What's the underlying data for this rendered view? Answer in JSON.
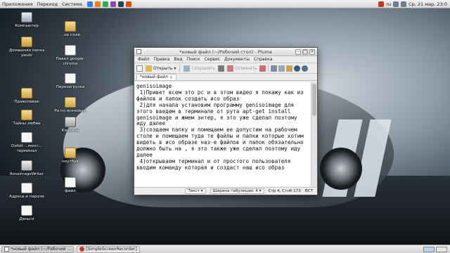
{
  "top_panel": {
    "menus": [
      "Приложения",
      "Переход",
      "Система"
    ],
    "lang": "ru",
    "clock": "Ср, 21 мар, 23:0"
  },
  "desktop": {
    "icons": [
      {
        "label": "Компьютер",
        "icon": "computer-icon"
      },
      {
        "label": "Домашняя папка paulo",
        "icon": "home-folder-icon"
      },
      {
        "label": "Праволавие",
        "icon": "folder-icon"
      },
      {
        "label": "Тайны любви",
        "icon": "folder-icon"
      },
      {
        "label": "Defolt ...монт... терминал",
        "icon": "file-icon"
      },
      {
        "label": "RosalmageWriter",
        "icon": "printer-icon"
      },
      {
        "label": "Адреса и пароли",
        "icon": "file-icon"
      },
      {
        "label": "Деньги",
        "icon": "file-icon"
      },
      {
        "label": "...ое поле",
        "icon": "folder-icon"
      },
      {
        "label": "Павел google-chrome",
        "icon": "file-icon"
      },
      {
        "label": "Перезагрузка",
        "icon": "file-icon"
      },
      {
        "label": "Ра по ясеновам",
        "icon": "folder-icon"
      },
      {
        "label": "Корзина",
        "icon": "trash-icon"
      },
      {
        "label": "ноутбук",
        "icon": "folder-icon"
      },
      {
        "label": "файл",
        "icon": "file-icon"
      }
    ]
  },
  "window": {
    "title": "*новый файл (~/Рабочий стол) - Pluma",
    "menus": [
      "Файл",
      "Правка",
      "Вид",
      "Поиск",
      "Сервис",
      "Документы",
      "Справка"
    ],
    "toolbar": {
      "open": "Открыть",
      "save": "Сохранить",
      "undo": "Отменить"
    },
    "tab_label": "*новый файл",
    "text": "genisoimage\n 1)Привет всем это рс и в этом видео я покажу как из файлов и папок создать исо образ\n 2)для начала установим программу genisoimage для этого введем в терминале от рута apt-get install genisoimage и жмем энтер, я это уже сделал поэтому иду далее\n 3)создаем папку и помещаем ее допустим на рабочем столе и помещаем туда те файлы и папки которые хотим видеть в исо образе наз-е файлов и папок обязательно должно быть на , я это также уже сделал поэтому иду далее\n 4)открываем терминал и от простого пользователя вводим команду которая и создаст наш исо образ",
    "status": {
      "mode": "Текст",
      "tab_width": "Ширина табуляции: 4",
      "position": "Стр 4, Стлб 173",
      "ins": "ВСТ"
    }
  },
  "taskbar": {
    "items": [
      {
        "label": "*новый файл (~/Рабочий ...",
        "active": true
      },
      {
        "label": "[SimpleScreenRecorder]",
        "active": false
      }
    ]
  },
  "colors": {
    "launcher1": "#3a7bd5",
    "launcher2": "#e67e22",
    "launcher3": "#27ae60",
    "launcher4": "#8e44ad",
    "launcher5": "#2c3e50",
    "launcher6": "#d35400"
  }
}
